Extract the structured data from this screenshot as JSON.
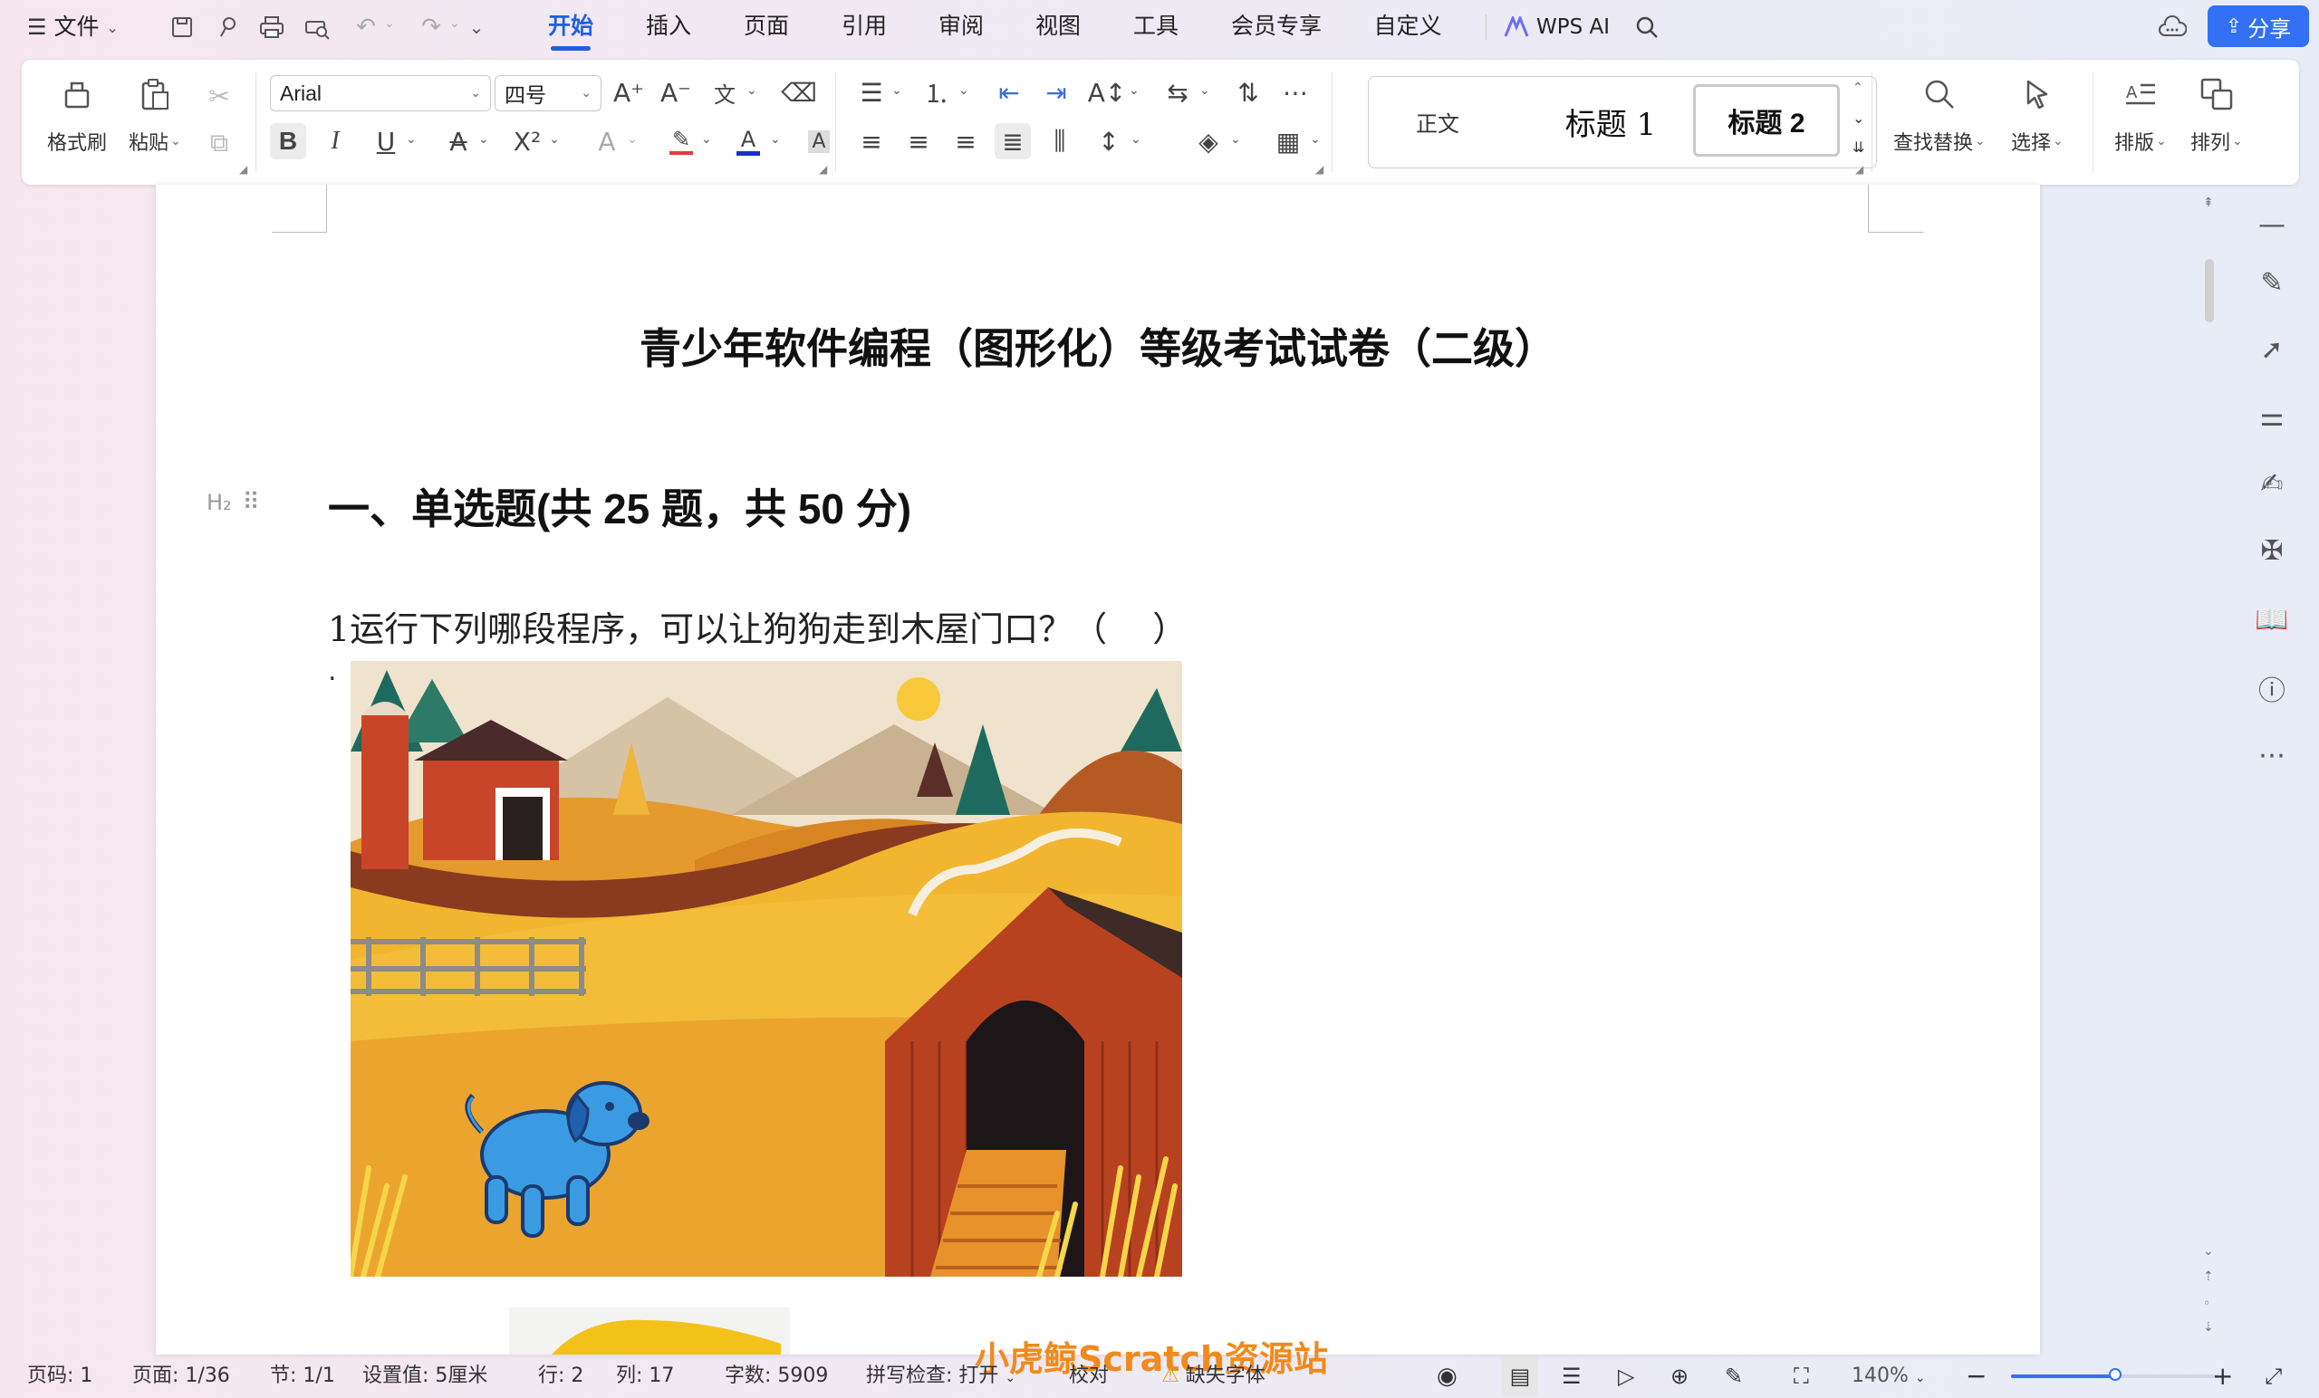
{
  "menubar": {
    "file_label": "文件",
    "tabs": [
      "开始",
      "插入",
      "页面",
      "引用",
      "审阅",
      "视图",
      "工具",
      "会员专享",
      "自定义"
    ],
    "active_tab": "开始",
    "ai_label": "WPS AI",
    "share_label": "分享"
  },
  "ribbon": {
    "format_painter": "格式刷",
    "paste": "粘贴",
    "font_name": "Arial",
    "font_size": "四号",
    "styles": {
      "normal": "正文",
      "heading1": "标题 1",
      "heading2": "标题 2"
    },
    "find_replace": "查找替换",
    "select": "选择",
    "layout": "排版",
    "arrange": "排列",
    "font_color": "#1a2fd0",
    "highlight_color": "#e23b3b"
  },
  "document": {
    "title": "青少年软件编程（图形化）等级考试试卷（二级）",
    "heading_marker": "H₂",
    "section_heading": "一、单选题(共 25 题，共 50 分)",
    "question_1": "1运行下列哪段程序，可以让狗狗走到木屋门口？（　 ）",
    "bullet": "."
  },
  "status": {
    "page_code": "页码: 1",
    "page": "页面: 1/36",
    "section": "节: 1/1",
    "setting": "设置值: 5厘米",
    "row": "行: 2",
    "col": "列: 17",
    "word_count": "字数: 5909",
    "spell_check": "拼写检查: 打开",
    "proofread": "校对",
    "missing_font": "缺失字体",
    "zoom": "140%",
    "zoom_level_percent": 140
  },
  "watermark": "小虎鲸Scratch资源站",
  "icons": {
    "accent": "#1f5fe0",
    "share_bg": "#3370f5"
  }
}
